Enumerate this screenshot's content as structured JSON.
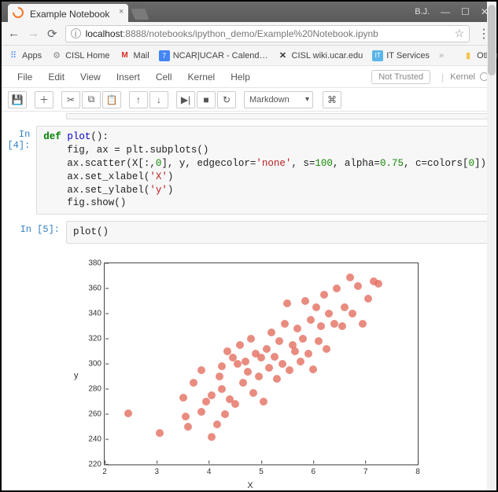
{
  "browser": {
    "tab_title": "Example Notebook",
    "user_badge": "B.J.",
    "url_host": "localhost",
    "url_port_path": ":8888/notebooks/ipython_demo/Example%20Notebook.ipynb"
  },
  "bookmarks": {
    "apps": "Apps",
    "cisl_home": "CISL Home",
    "mail": "Mail",
    "ncar": "NCAR|UCAR - Calend…",
    "wiki": "CISL wiki.ucar.edu",
    "it": "IT Services",
    "more": "»",
    "other": "Other bookmarks"
  },
  "jupyter": {
    "menu": [
      "File",
      "Edit",
      "View",
      "Insert",
      "Cell",
      "Kernel",
      "Help"
    ],
    "not_trusted": "Not Trusted",
    "kernel_label": "Kernel",
    "cell_type": "Markdown"
  },
  "cells": {
    "c0": {
      "prompt": "In [4]:"
    },
    "c1": {
      "prompt": "In [5]:",
      "code": "plot()"
    }
  },
  "code4": {
    "l1a": "def",
    "l1b": " plot",
    "l1c": "():",
    "l2": "    fig, ax = plt.subplots()",
    "l3a": "    ax.scatter(X[:,",
    "l3b": "0",
    "l3c": "], y, edgecolor=",
    "l3d": "'none'",
    "l3e": ", s=",
    "l3f": "100",
    "l3g": ", alpha=",
    "l3h": "0.75",
    "l3i": ", c=colors[",
    "l3j": "0",
    "l3k": "])",
    "l4a": "    ax.set_xlabel(",
    "l4b": "'X'",
    "l4c": ")",
    "l5a": "    ax.set_ylabel(",
    "l5b": "'y'",
    "l5c": ")",
    "l6": "    fig.show()"
  },
  "chart_data": {
    "type": "scatter",
    "xlabel": "X",
    "ylabel": "y",
    "xlim": [
      2,
      8
    ],
    "ylim": [
      220,
      380
    ],
    "xticks": [
      2,
      3,
      4,
      5,
      6,
      7,
      8
    ],
    "yticks": [
      220,
      240,
      260,
      280,
      300,
      320,
      340,
      360,
      380
    ],
    "points": [
      [
        2.45,
        261
      ],
      [
        3.05,
        245
      ],
      [
        3.5,
        273
      ],
      [
        3.55,
        258
      ],
      [
        3.6,
        250
      ],
      [
        3.7,
        285
      ],
      [
        3.85,
        262
      ],
      [
        3.85,
        295
      ],
      [
        3.95,
        270
      ],
      [
        4.05,
        275
      ],
      [
        4.05,
        242
      ],
      [
        4.15,
        252
      ],
      [
        4.2,
        290
      ],
      [
        4.25,
        280
      ],
      [
        4.25,
        298
      ],
      [
        4.3,
        260
      ],
      [
        4.35,
        310
      ],
      [
        4.4,
        272
      ],
      [
        4.45,
        305
      ],
      [
        4.5,
        268
      ],
      [
        4.55,
        300
      ],
      [
        4.6,
        315
      ],
      [
        4.65,
        285
      ],
      [
        4.7,
        302
      ],
      [
        4.75,
        294
      ],
      [
        4.8,
        320
      ],
      [
        4.85,
        277
      ],
      [
        4.9,
        308
      ],
      [
        4.95,
        290
      ],
      [
        5.0,
        305
      ],
      [
        5.05,
        270
      ],
      [
        5.1,
        312
      ],
      [
        5.15,
        297
      ],
      [
        5.2,
        325
      ],
      [
        5.25,
        306
      ],
      [
        5.3,
        288
      ],
      [
        5.35,
        318
      ],
      [
        5.4,
        300
      ],
      [
        5.45,
        332
      ],
      [
        5.5,
        348
      ],
      [
        5.55,
        295
      ],
      [
        5.6,
        315
      ],
      [
        5.65,
        310
      ],
      [
        5.7,
        328
      ],
      [
        5.75,
        302
      ],
      [
        5.8,
        320
      ],
      [
        5.85,
        350
      ],
      [
        5.9,
        308
      ],
      [
        5.95,
        335
      ],
      [
        6.0,
        296
      ],
      [
        6.05,
        345
      ],
      [
        6.1,
        318
      ],
      [
        6.15,
        330
      ],
      [
        6.2,
        355
      ],
      [
        6.25,
        312
      ],
      [
        6.3,
        340
      ],
      [
        6.4,
        332
      ],
      [
        6.45,
        360
      ],
      [
        6.55,
        330
      ],
      [
        6.6,
        345
      ],
      [
        6.7,
        369
      ],
      [
        6.75,
        340
      ],
      [
        6.85,
        362
      ],
      [
        6.95,
        332
      ],
      [
        7.05,
        352
      ],
      [
        7.15,
        366
      ],
      [
        7.25,
        364
      ]
    ]
  }
}
